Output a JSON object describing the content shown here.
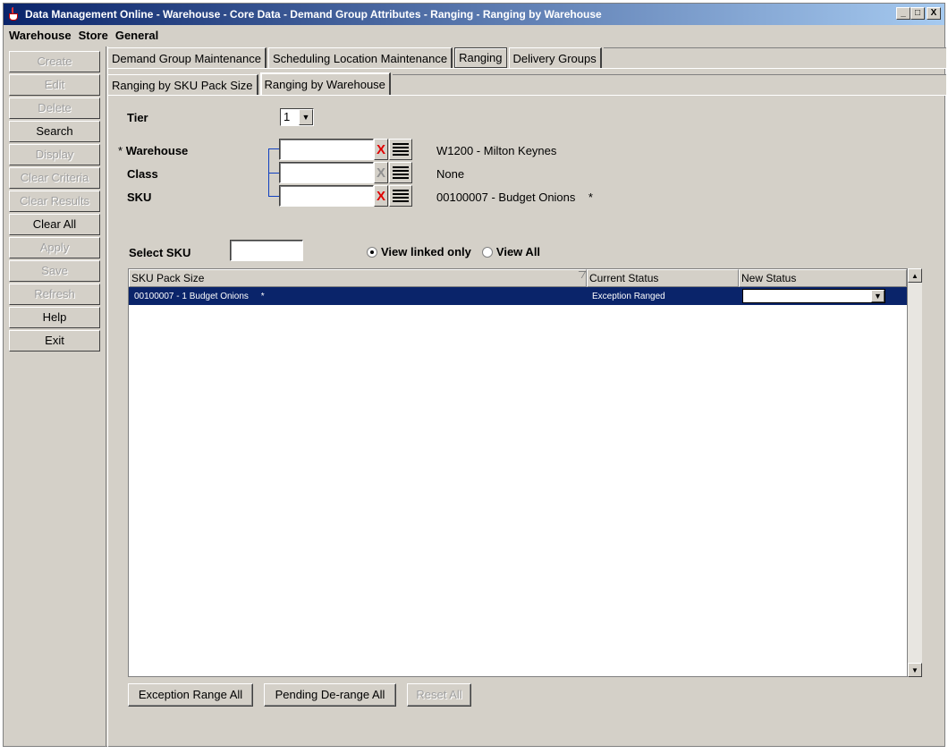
{
  "window": {
    "title": "Data Management Online - Warehouse - Core Data - Demand Group Attributes - Ranging - Ranging by Warehouse",
    "minimize": "_",
    "maximize": "□",
    "close": "X"
  },
  "menu": {
    "items": [
      "Warehouse",
      "Store",
      "General"
    ]
  },
  "sidebar": {
    "buttons": [
      {
        "label": "Create",
        "enabled": false
      },
      {
        "label": "Edit",
        "enabled": false
      },
      {
        "label": "Delete",
        "enabled": false
      },
      {
        "label": "Search",
        "enabled": true
      },
      {
        "label": "Display",
        "enabled": false
      },
      {
        "label": "Clear Criteria",
        "enabled": false
      },
      {
        "label": "Clear Results",
        "enabled": false
      },
      {
        "label": "Clear All",
        "enabled": true
      },
      {
        "label": "Apply",
        "enabled": false
      },
      {
        "label": "Save",
        "enabled": false
      },
      {
        "label": "Refresh",
        "enabled": false
      },
      {
        "label": "Help",
        "enabled": true
      },
      {
        "label": "Exit",
        "enabled": true
      }
    ]
  },
  "tabs": {
    "main": [
      "Demand Group Maintenance",
      "Scheduling Location Maintenance",
      "Ranging",
      "Delivery Groups"
    ],
    "main_active": "Ranging",
    "sub": [
      "Ranging by SKU Pack Size",
      "Ranging by Warehouse"
    ],
    "sub_active": "Ranging by Warehouse"
  },
  "form": {
    "tier_label": "Tier",
    "tier_value": "1",
    "required_star": "*",
    "warehouse_label": "Warehouse",
    "warehouse_value": "",
    "warehouse_desc": "W1200 - Milton Keynes",
    "class_label": "Class",
    "class_value": "",
    "class_desc": "None",
    "sku_label": "SKU",
    "sku_value": "",
    "sku_desc": "00100007 - Budget Onions",
    "sku_desc_star": "*",
    "clear_glyph": "X",
    "select_sku_label": "Select SKU",
    "select_sku_value": "",
    "view_linked_only": "View linked only",
    "view_all": "View All",
    "view_selected": "linked"
  },
  "table": {
    "columns": [
      "SKU Pack Size",
      "Current Status",
      "New Status"
    ],
    "rows": [
      {
        "sku": "00100007 - 1 Budget Onions",
        "star": "*",
        "current_status": "Exception Ranged",
        "new_status": ""
      }
    ]
  },
  "footer_buttons": [
    {
      "label": "Exception Range All",
      "enabled": true
    },
    {
      "label": "Pending De-range All",
      "enabled": true
    },
    {
      "label": "Reset All",
      "enabled": false
    }
  ],
  "icons": {
    "scroll_up": "▲",
    "scroll_down": "▼",
    "dropdown": "▼"
  },
  "colors": {
    "selection": "#0a246a",
    "clear_red": "#e00000",
    "link_line": "#1040c0"
  }
}
